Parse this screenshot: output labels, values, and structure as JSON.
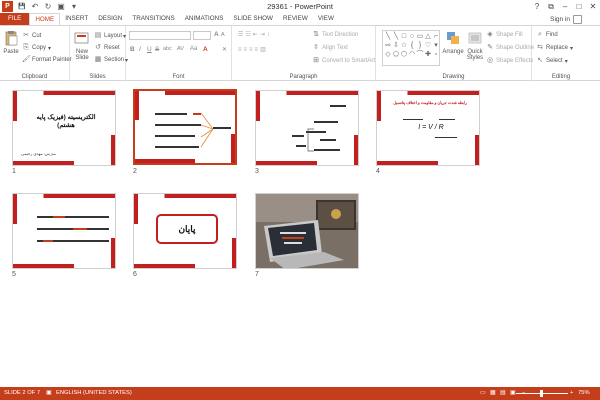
{
  "window": {
    "title": "29361 - PowerPoint",
    "app_icon": "P",
    "min": "–",
    "max": "□",
    "close": "✕",
    "help": "?",
    "restore": "⧉"
  },
  "qat": {
    "save": "💾",
    "undo": "↶",
    "redo": "↻",
    "present": "▣",
    "more": "▾"
  },
  "tabs": [
    {
      "label": "FILE"
    },
    {
      "label": "HOME"
    },
    {
      "label": "INSERT"
    },
    {
      "label": "DESIGN"
    },
    {
      "label": "TRANSITIONS"
    },
    {
      "label": "ANIMATIONS"
    },
    {
      "label": "SLIDE SHOW"
    },
    {
      "label": "REVIEW"
    },
    {
      "label": "VIEW"
    }
  ],
  "signin": "Sign in",
  "ribbon": {
    "clipboard": {
      "name": "Clipboard",
      "paste": "Paste",
      "cut": "Cut",
      "copy": "Copy",
      "format_painter": "Format Painter"
    },
    "slides": {
      "name": "Slides",
      "new_slide_1": "New",
      "new_slide_2": "Slide",
      "layout": "Layout",
      "reset": "Reset",
      "section": "Section"
    },
    "font": {
      "name": "Font",
      "bold": "B",
      "italic": "I",
      "underline": "U",
      "strike": "S",
      "shadow": "abc",
      "spacing": "AV",
      "case": "Aa",
      "grow": "A",
      "shrink": "A",
      "clear": "✕",
      "color": "A"
    },
    "paragraph": {
      "name": "Paragraph",
      "text_direction": "Text Direction",
      "align_text": "Align Text",
      "smartart": "Convert to SmartArt"
    },
    "drawing": {
      "name": "Drawing",
      "arrange": "Arrange",
      "quick_styles_1": "Quick",
      "quick_styles_2": "Styles",
      "shape_fill": "Shape Fill",
      "shape_outline": "Shape Outline",
      "shape_effects": "Shape Effects"
    },
    "editing": {
      "name": "Editing",
      "find": "Find",
      "replace": "Replace",
      "select": "Select"
    }
  },
  "slides": [
    {
      "num": "1",
      "title": "الکتریسیته (فیزیک پایه هشتم)",
      "subtitle": "مدرس: مهدی رحیمی"
    },
    {
      "num": "2"
    },
    {
      "num": "3"
    },
    {
      "num": "4",
      "title": "رابطه شدت جریان و مقاومت و اختلاف پتانسیل",
      "formula": "I = V / R"
    },
    {
      "num": "5"
    },
    {
      "num": "6",
      "title": "پایان"
    },
    {
      "num": "7"
    }
  ],
  "status": {
    "slide": "SLIDE 2 OF 7",
    "lang": "ENGLISH (UNITED STATES)",
    "zoom": "75%"
  }
}
